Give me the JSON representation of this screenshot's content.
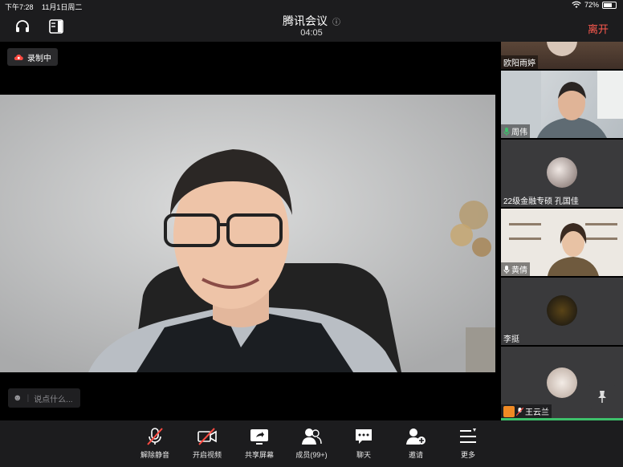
{
  "status_bar": {
    "time": "下午7:28",
    "date": "11月1日周二",
    "battery": "72%",
    "battery_level": 0.72
  },
  "header": {
    "title": "腾讯会议",
    "timer": "04:05",
    "leave_label": "离开"
  },
  "main": {
    "recording_label": "录制中",
    "chat_placeholder": "说点什么..."
  },
  "participants": [
    {
      "name": "欧阳雨婷",
      "mic": false
    },
    {
      "name": "周伟",
      "mic": true
    },
    {
      "name": "22级金融专硕 孔国佳",
      "mic": false
    },
    {
      "name": "黄倩",
      "mic": true
    },
    {
      "name": "李挺",
      "mic": false
    },
    {
      "name": "王云兰",
      "mic": "muted"
    }
  ],
  "toolbar": {
    "unmute": "解除静音",
    "video": "开启视频",
    "share": "共享屏幕",
    "members": "成员(99+)",
    "chat": "聊天",
    "invite": "邀请",
    "more": "更多"
  },
  "colors": {
    "accent_red": "#ff5a4f",
    "bar_bg": "#1c1c1e",
    "mic_green": "#3ec06b"
  }
}
